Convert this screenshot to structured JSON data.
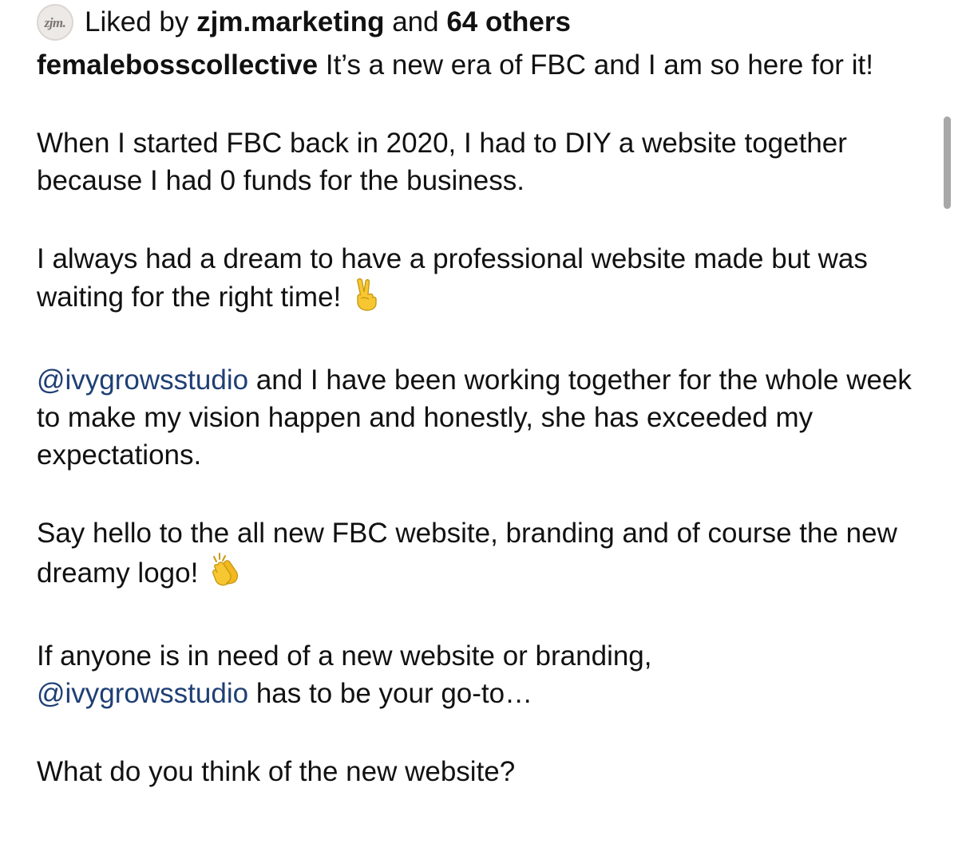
{
  "likes": {
    "prefix": "Liked by",
    "first_user": "zjm.marketing",
    "joiner": "and",
    "others": "64 others",
    "avatar_text": "zjm."
  },
  "caption": {
    "username": "femalebosscollective",
    "p1": "It’s a new era of FBC and I am so here for it!",
    "p2": "When I started FBC back in 2020, I had to DIY a website together because I had 0 funds for the business.",
    "p3": "I always had a dream to have a professional website made but was waiting for the right time!",
    "p3_emoji": "victory-hand-emoji",
    "p4_mention": "@ivygrowsstudio",
    "p4": "and I have been working together for the whole week to make my vision happen and honestly, she has exceeded my expectations.",
    "p5": "Say hello to the all new FBC website, branding and of course the new dreamy logo!",
    "p5_emoji": "clapping-hands-emoji",
    "p6_a": "If anyone is in need of a new website or branding,",
    "p6_mention": "@ivygrowsstudio",
    "p6_b": "has to be your go-to…",
    "p7": "What do you think of the new website?"
  },
  "colors": {
    "text": "#111111",
    "mention": "#1f3f75",
    "scrollbar": "#a8a8a8",
    "emoji_yellow": "#f7c731"
  }
}
